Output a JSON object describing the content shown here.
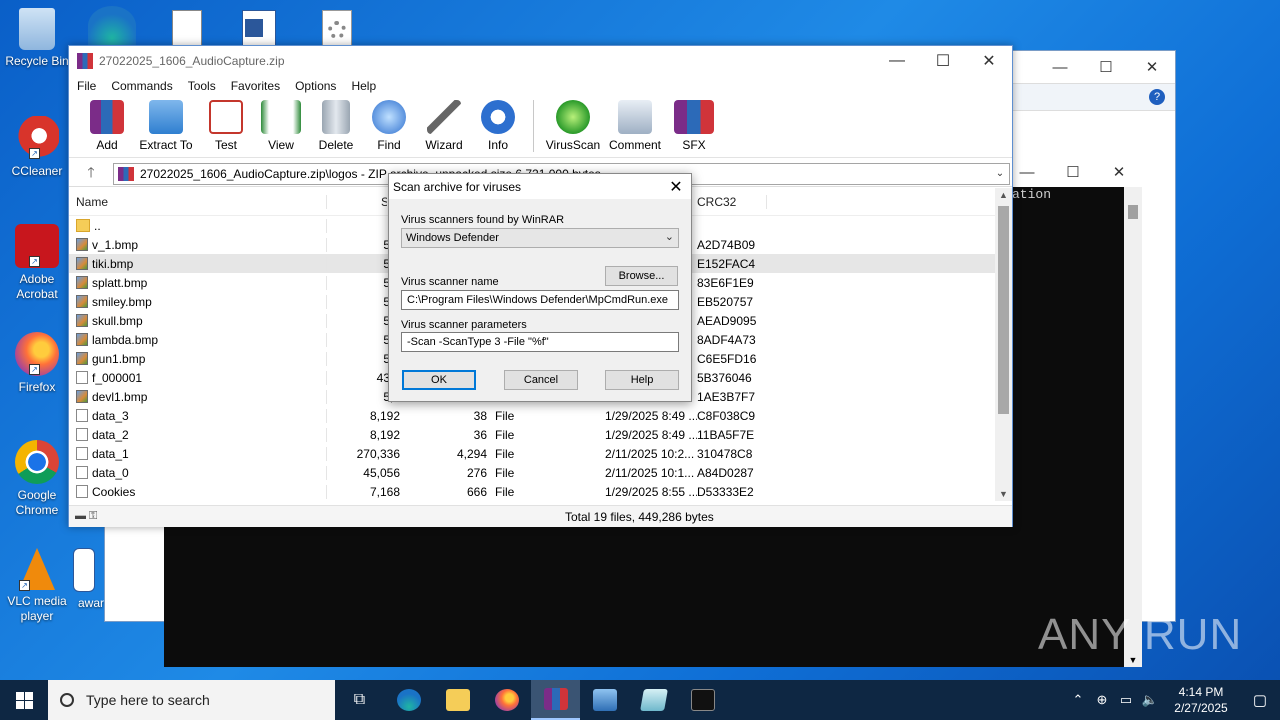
{
  "desktop": {
    "icons": [
      {
        "label": "Recycle Bin"
      },
      {
        "label": "CCleaner"
      },
      {
        "label": "Adobe Acrobat"
      },
      {
        "label": "Firefox"
      },
      {
        "label": "Google Chrome"
      },
      {
        "label": "VLC media player"
      },
      {
        "label": "awar"
      }
    ]
  },
  "terminal": {
    "text": "ation"
  },
  "watermark": "ANY RUN",
  "winrar": {
    "title": "27022025_1606_AudioCapture.zip",
    "menu": [
      "File",
      "Commands",
      "Tools",
      "Favorites",
      "Options",
      "Help"
    ],
    "toolbar": [
      "Add",
      "Extract To",
      "Test",
      "View",
      "Delete",
      "Find",
      "Wizard",
      "Info",
      "VirusScan",
      "Comment",
      "SFX"
    ],
    "address": "27022025_1606_AudioCapture.zip\\logos - ZIP archive, unpacked size 6,721,000 bytes",
    "columns": {
      "name": "Name",
      "size": "S",
      "crc": "CRC32"
    },
    "files": [
      {
        "name": "..",
        "size": "",
        "packed": "",
        "type": "",
        "modified": "",
        "crc": "",
        "icon": "folder"
      },
      {
        "name": "v_1.bmp",
        "size": "5,1",
        "packed": "",
        "type": "",
        "modified": "",
        "crc": "A2D74B09",
        "icon": "bmp"
      },
      {
        "name": "tiki.bmp",
        "size": "5,1",
        "packed": "",
        "type": "",
        "modified": "",
        "crc": "E152FAC4",
        "icon": "bmp"
      },
      {
        "name": "splatt.bmp",
        "size": "5,1",
        "packed": "",
        "type": "",
        "modified": "",
        "crc": "83E6F1E9",
        "icon": "bmp"
      },
      {
        "name": "smiley.bmp",
        "size": "5,1",
        "packed": "",
        "type": "",
        "modified": "",
        "crc": "EB520757",
        "icon": "bmp"
      },
      {
        "name": "skull.bmp",
        "size": "5,1",
        "packed": "",
        "type": "",
        "modified": "",
        "crc": "AEAD9095",
        "icon": "bmp"
      },
      {
        "name": "lambda.bmp",
        "size": "5,1",
        "packed": "",
        "type": "",
        "modified": "",
        "crc": "8ADF4A73",
        "icon": "bmp"
      },
      {
        "name": "gun1.bmp",
        "size": "5,1",
        "packed": "",
        "type": "",
        "modified": "",
        "crc": "C6E5FD16",
        "icon": "bmp"
      },
      {
        "name": "f_000001",
        "size": "43,0",
        "packed": "",
        "type": "",
        "modified": "",
        "crc": "5B376046",
        "icon": "file"
      },
      {
        "name": "devl1.bmp",
        "size": "5,1",
        "packed": "",
        "type": "",
        "modified": "",
        "crc": "1AE3B7F7",
        "icon": "bmp"
      },
      {
        "name": "data_3",
        "size": "8,192",
        "packed": "38",
        "type": "File",
        "modified": "1/29/2025 8:49 ...",
        "crc": "C8F038C9",
        "icon": "file"
      },
      {
        "name": "data_2",
        "size": "8,192",
        "packed": "36",
        "type": "File",
        "modified": "1/29/2025 8:49 ...",
        "crc": "11BA5F7E",
        "icon": "file"
      },
      {
        "name": "data_1",
        "size": "270,336",
        "packed": "4,294",
        "type": "File",
        "modified": "2/11/2025 10:2...",
        "crc": "310478C8",
        "icon": "file"
      },
      {
        "name": "data_0",
        "size": "45,056",
        "packed": "276",
        "type": "File",
        "modified": "2/11/2025 10:1...",
        "crc": "A84D0287",
        "icon": "file"
      },
      {
        "name": "Cookies",
        "size": "7,168",
        "packed": "666",
        "type": "File",
        "modified": "1/29/2025 8:55 ...",
        "crc": "D53333E2",
        "icon": "file"
      }
    ],
    "status": "Total 19 files, 449,286 bytes"
  },
  "dialog": {
    "title": "Scan archive for viruses",
    "scanners_label": "Virus scanners found by WinRAR",
    "scanner_selected": "Windows Defender",
    "browse": "Browse...",
    "name_label": "Virus scanner name",
    "name_value": "C:\\Program Files\\Windows Defender\\MpCmdRun.exe",
    "params_label": "Virus scanner parameters",
    "params_value": "-Scan -ScanType 3 -File \"%f\"",
    "ok": "OK",
    "cancel": "Cancel",
    "help": "Help"
  },
  "taskbar": {
    "search_placeholder": "Type here to search",
    "time": "4:14 PM",
    "date": "2/27/2025"
  },
  "colors": {
    "accent": "#0078d7",
    "taskbar": "#0e2743"
  }
}
